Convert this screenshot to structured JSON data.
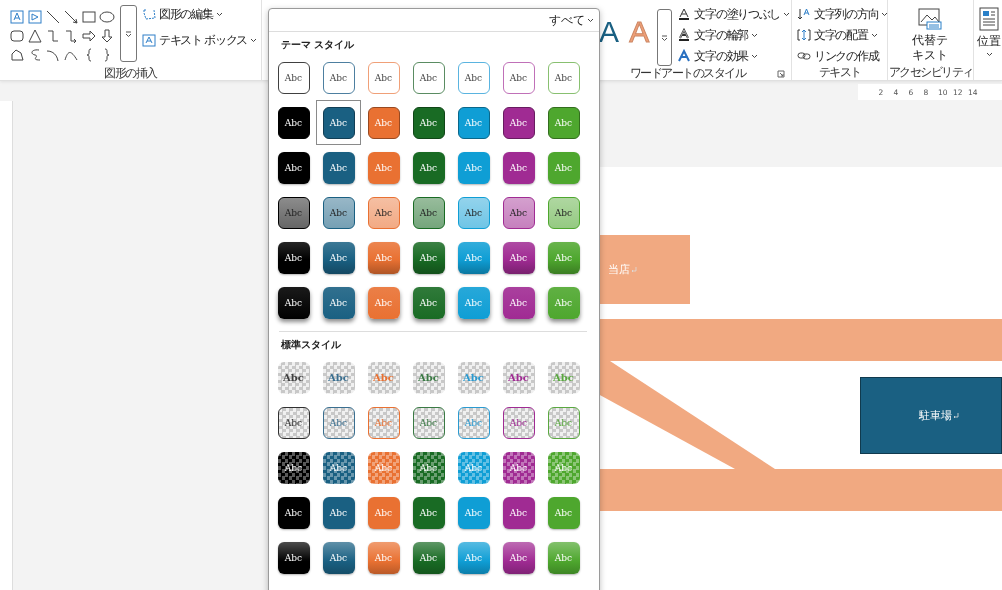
{
  "ribbon": {
    "shapes_group": {
      "label": "図形の挿入",
      "commands": [
        {
          "label": "図形の編集",
          "dropdown": true
        },
        {
          "label": "テキスト ボックス",
          "dropdown": true
        }
      ]
    },
    "wordart_group": {
      "label": "ワードアートのスタイル",
      "samples": [
        {
          "text": "A",
          "kind": "filled",
          "color": "#1a6082"
        },
        {
          "text": "A",
          "kind": "outlined",
          "color": "#f0a078"
        }
      ],
      "commands": [
        {
          "label": "文字の塗りつぶし",
          "dropdown": true
        },
        {
          "label": "文字の輪郭",
          "dropdown": true
        },
        {
          "label": "文字の効果",
          "dropdown": true
        }
      ]
    },
    "text_group": {
      "label": "テキスト",
      "commands": [
        {
          "label": "文字列の方向",
          "dropdown": true
        },
        {
          "label": "文字の配置",
          "dropdown": true
        },
        {
          "label": "リンクの作成",
          "dropdown": false
        }
      ]
    },
    "accessibility_group": {
      "label": "アクセシビリティ",
      "button": "代替テキスト"
    },
    "position_button": {
      "label": "位置",
      "dropdown": true
    }
  },
  "gallery": {
    "filter": "すべて",
    "sections": [
      {
        "title": "テーマ スタイル",
        "rows": [
          {
            "kind": "outline",
            "items": [
              {
                "text": "Abc",
                "color": "#404040",
                "selected": false
              },
              {
                "text": "Abc",
                "color": "#4d7fa0",
                "selected": false
              },
              {
                "text": "Abc",
                "color": "#f0a078",
                "selected": false
              },
              {
                "text": "Abc",
                "color": "#5a8c62",
                "selected": false
              },
              {
                "text": "Abc",
                "color": "#5ab4e0",
                "selected": false
              },
              {
                "text": "Abc",
                "color": "#c070b8",
                "selected": false
              },
              {
                "text": "Abc",
                "color": "#88c070",
                "selected": false
              }
            ]
          },
          {
            "kind": "solid",
            "items": [
              {
                "text": "Abc",
                "color": "#000000",
                "selected": false
              },
              {
                "text": "Abc",
                "color": "#1a6082",
                "selected": true
              },
              {
                "text": "Abc",
                "color": "#e97132",
                "selected": false
              },
              {
                "text": "Abc",
                "color": "#196b24",
                "selected": false
              },
              {
                "text": "Abc",
                "color": "#0f9ed5",
                "selected": false
              },
              {
                "text": "Abc",
                "color": "#a02b93",
                "selected": false
              },
              {
                "text": "Abc",
                "color": "#4ea72e",
                "selected": false
              }
            ]
          },
          {
            "kind": "plain",
            "items": [
              {
                "text": "Abc",
                "color": "#000000",
                "selected": false
              },
              {
                "text": "Abc",
                "color": "#1a6082",
                "selected": false
              },
              {
                "text": "Abc",
                "color": "#e97132",
                "selected": false
              },
              {
                "text": "Abc",
                "color": "#196b24",
                "selected": false
              },
              {
                "text": "Abc",
                "color": "#0f9ed5",
                "selected": false
              },
              {
                "text": "Abc",
                "color": "#a02b93",
                "selected": false
              },
              {
                "text": "Abc",
                "color": "#4ea72e",
                "selected": false
              }
            ]
          },
          {
            "kind": "light",
            "items": [
              {
                "text": "Abc",
                "color": "#000000",
                "selected": false
              },
              {
                "text": "Abc",
                "color": "#1a6082",
                "selected": false
              },
              {
                "text": "Abc",
                "color": "#e97132",
                "selected": false
              },
              {
                "text": "Abc",
                "color": "#196b24",
                "selected": false
              },
              {
                "text": "Abc",
                "color": "#0f9ed5",
                "selected": false
              },
              {
                "text": "Abc",
                "color": "#a02b93",
                "selected": false
              },
              {
                "text": "Abc",
                "color": "#4ea72e",
                "selected": false
              }
            ]
          },
          {
            "kind": "glossy",
            "items": [
              {
                "text": "Abc",
                "color": "#000000",
                "selected": false
              },
              {
                "text": "Abc",
                "color": "#1a6082",
                "selected": false
              },
              {
                "text": "Abc",
                "color": "#e97132",
                "selected": false
              },
              {
                "text": "Abc",
                "color": "#196b24",
                "selected": false
              },
              {
                "text": "Abc",
                "color": "#0f9ed5",
                "selected": false
              },
              {
                "text": "Abc",
                "color": "#a02b93",
                "selected": false
              },
              {
                "text": "Abc",
                "color": "#4ea72e",
                "selected": false
              }
            ]
          },
          {
            "kind": "raised",
            "items": [
              {
                "text": "Abc",
                "color": "#000000",
                "selected": false
              },
              {
                "text": "Abc",
                "color": "#1a6082",
                "selected": false
              },
              {
                "text": "Abc",
                "color": "#e97132",
                "selected": false
              },
              {
                "text": "Abc",
                "color": "#196b24",
                "selected": false
              },
              {
                "text": "Abc",
                "color": "#0f9ed5",
                "selected": false
              },
              {
                "text": "Abc",
                "color": "#a02b93",
                "selected": false
              },
              {
                "text": "Abc",
                "color": "#4ea72e",
                "selected": false
              }
            ]
          }
        ]
      },
      {
        "title": "標準スタイル",
        "rows": [
          {
            "kind": "checker",
            "items": [
              {
                "text": "Abc",
                "color": "#404040",
                "selected": false
              },
              {
                "text": "Abc",
                "color": "#3a6f90",
                "selected": false
              },
              {
                "text": "Abc",
                "color": "#e97132",
                "selected": false
              },
              {
                "text": "Abc",
                "color": "#3a7a44",
                "selected": false
              },
              {
                "text": "Abc",
                "color": "#2a9ad0",
                "selected": false
              },
              {
                "text": "Abc",
                "color": "#a02b93",
                "selected": false
              },
              {
                "text": "Abc",
                "color": "#5aa840",
                "selected": false
              }
            ]
          },
          {
            "kind": "checker-outline",
            "items": [
              {
                "text": "Abc",
                "color": "#303030",
                "selected": false
              },
              {
                "text": "Abc",
                "color": "#3a6f90",
                "selected": false
              },
              {
                "text": "Abc",
                "color": "#e97132",
                "selected": false
              },
              {
                "text": "Abc",
                "color": "#3a7a44",
                "selected": false
              },
              {
                "text": "Abc",
                "color": "#2a9ad0",
                "selected": false
              },
              {
                "text": "Abc",
                "color": "#a02b93",
                "selected": false
              },
              {
                "text": "Abc",
                "color": "#5aa840",
                "selected": false
              }
            ]
          },
          {
            "kind": "checker-tint",
            "items": [
              {
                "text": "Abc",
                "color": "#000000",
                "selected": false
              },
              {
                "text": "Abc",
                "color": "#1a6082",
                "selected": false
              },
              {
                "text": "Abc",
                "color": "#e97132",
                "selected": false
              },
              {
                "text": "Abc",
                "color": "#196b24",
                "selected": false
              },
              {
                "text": "Abc",
                "color": "#0f9ed5",
                "selected": false
              },
              {
                "text": "Abc",
                "color": "#a02b93",
                "selected": false
              },
              {
                "text": "Abc",
                "color": "#4ea72e",
                "selected": false
              }
            ]
          },
          {
            "kind": "plain",
            "items": [
              {
                "text": "Abc",
                "color": "#000000",
                "selected": false
              },
              {
                "text": "Abc",
                "color": "#1a6082",
                "selected": false
              },
              {
                "text": "Abc",
                "color": "#e97132",
                "selected": false
              },
              {
                "text": "Abc",
                "color": "#196b24",
                "selected": false
              },
              {
                "text": "Abc",
                "color": "#0f9ed5",
                "selected": false
              },
              {
                "text": "Abc",
                "color": "#a02b93",
                "selected": false
              },
              {
                "text": "Abc",
                "color": "#4ea72e",
                "selected": false
              }
            ]
          },
          {
            "kind": "gradient",
            "items": [
              {
                "text": "Abc",
                "color": "#000000",
                "selected": false
              },
              {
                "text": "Abc",
                "color": "#1a6082",
                "selected": false
              },
              {
                "text": "Abc",
                "color": "#e97132",
                "selected": false
              },
              {
                "text": "Abc",
                "color": "#196b24",
                "selected": false
              },
              {
                "text": "Abc",
                "color": "#0f9ed5",
                "selected": false
              },
              {
                "text": "Abc",
                "color": "#a02b93",
                "selected": false
              },
              {
                "text": "Abc",
                "color": "#4ea72e",
                "selected": false
              }
            ]
          }
        ]
      }
    ]
  },
  "ruler": {
    "ticks": [
      "2",
      "4",
      "6",
      "8",
      "10",
      "12",
      "14"
    ]
  },
  "document": {
    "shapes": [
      {
        "kind": "label-box",
        "text": "当店",
        "color": "#f1a981"
      },
      {
        "kind": "label-box",
        "text": "駐車場",
        "color": "#1a6082"
      }
    ]
  }
}
